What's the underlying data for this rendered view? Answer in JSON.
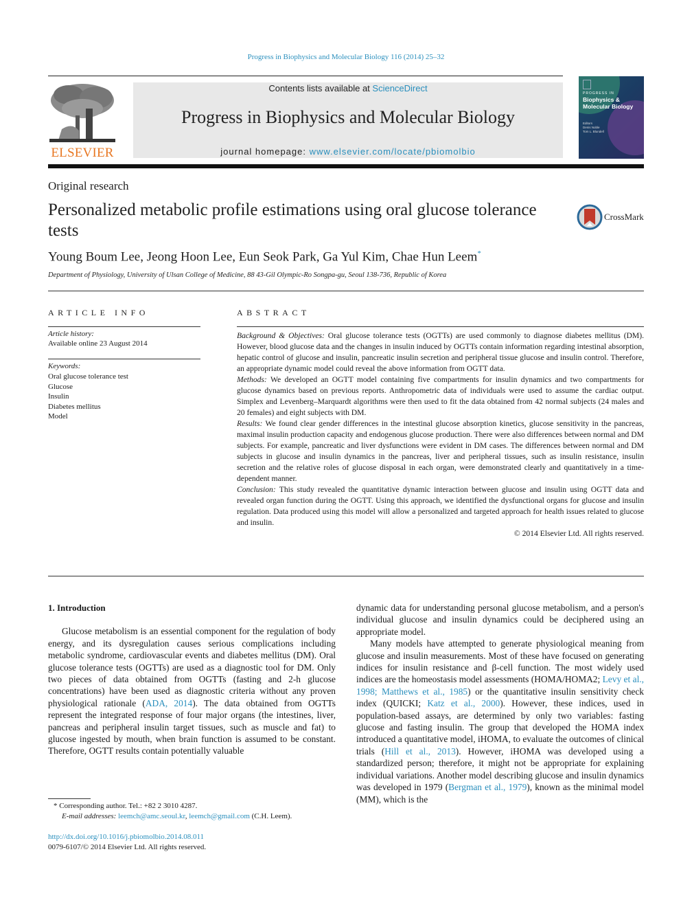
{
  "header": {
    "journal_ref": "Progress in Biophysics and Molecular Biology 116 (2014) 25–32",
    "publisher_logo_text": "ELSEVIER",
    "contents_prefix": "Contents lists available at ",
    "contents_link": "ScienceDirect",
    "journal_title": "Progress in Biophysics and Molecular Biology",
    "homepage_prefix": "journal homepage: ",
    "homepage_link": "www.elsevier.com/locate/pbiomolbio",
    "cover": {
      "small_title": "PROGRESS IN",
      "title": "Biophysics & Molecular Biology",
      "editors_label": "Editors",
      "editors": [
        "Denis Noble",
        "Tom L. Blundell"
      ]
    },
    "colors": {
      "link": "#2a8fbd",
      "elsevier_orange": "#e87722",
      "banner_bg": "#e8e8e8"
    }
  },
  "article": {
    "type": "Original research",
    "title": "Personalized metabolic profile estimations using oral glucose tolerance tests",
    "crossmark_label": "CrossMark",
    "authors": "Young Boum Lee, Jeong Hoon Lee, Eun Seok Park, Ga Yul Kim, Chae Hun Leem",
    "corresponding_mark": "*",
    "affiliation": "Department of Physiology, University of Ulsan College of Medicine, 88 43-Gil Olympic-Ro Songpa-gu, Seoul 138-736, Republic of Korea"
  },
  "article_info": {
    "heading": "ARTICLE INFO",
    "history_label": "Article history:",
    "history_value": "Available online 23 August 2014",
    "keywords_label": "Keywords:",
    "keywords": [
      "Oral glucose tolerance test",
      "Glucose",
      "Insulin",
      "Diabetes mellitus",
      "Model"
    ]
  },
  "abstract": {
    "heading": "ABSTRACT",
    "sections": [
      {
        "label": "Background & Objectives:",
        "text": " Oral glucose tolerance tests (OGTTs) are used commonly to diagnose diabetes mellitus (DM). However, blood glucose data and the changes in insulin induced by OGTTs contain information regarding intestinal absorption, hepatic control of glucose and insulin, pancreatic insulin secretion and peripheral tissue glucose and insulin control. Therefore, an appropriate dynamic model could reveal the above information from OGTT data."
      },
      {
        "label": "Methods:",
        "text": " We developed an OGTT model containing five compartments for insulin dynamics and two compartments for glucose dynamics based on previous reports. Anthropometric data of individuals were used to assume the cardiac output. Simplex and Levenberg–Marquardt algorithms were then used to fit the data obtained from 42 normal subjects (24 males and 20 females) and eight subjects with DM."
      },
      {
        "label": "Results:",
        "text": " We found clear gender differences in the intestinal glucose absorption kinetics, glucose sensitivity in the pancreas, maximal insulin production capacity and endogenous glucose production. There were also differences between normal and DM subjects. For example, pancreatic and liver dysfunctions were evident in DM cases. The differences between normal and DM subjects in glucose and insulin dynamics in the pancreas, liver and peripheral tissues, such as insulin resistance, insulin secretion and the relative roles of glucose disposal in each organ, were demonstrated clearly and quantitatively in a time-dependent manner."
      },
      {
        "label": "Conclusion:",
        "text": " This study revealed the quantitative dynamic interaction between glucose and insulin using OGTT data and revealed organ function during the OGTT. Using this approach, we identified the dysfunctional organs for glucose and insulin regulation. Data produced using this model will allow a personalized and targeted approach for health issues related to glucose and insulin."
      }
    ],
    "copyright": "© 2014 Elsevier Ltd. All rights reserved."
  },
  "body": {
    "section_heading": "1.  Introduction",
    "left_p1_a": "Glucose metabolism is an essential component for the regulation of body energy, and its dysregulation causes serious complications including metabolic syndrome, cardiovascular events and diabetes mellitus (DM). Oral glucose tolerance tests (OGTTs) are used as a diagnostic tool for DM. Only two pieces of data obtained from OGTTs (fasting and 2-h glucose concentrations) have been used as diagnostic criteria without any proven physiological rationale (",
    "left_p1_cite1": "ADA, 2014",
    "left_p1_b": "). The data obtained from OGTTs represent the integrated response of four major organs (the intestines, liver, pancreas and peripheral insulin target tissues, such as muscle and fat) to glucose ingested by mouth, when brain function is assumed to be constant. Therefore, OGTT results contain potentially valuable",
    "right_p1": "dynamic data for understanding personal glucose metabolism, and a person's individual glucose and insulin dynamics could be deciphered using an appropriate model.",
    "right_p2_a": "Many models have attempted to generate physiological meaning from glucose and insulin measurements. Most of these have focused on generating indices for insulin resistance and β-cell function. The most widely used indices are the homeostasis model assessments (HOMA/HOMA2; ",
    "right_p2_cite1": "Levy et al., 1998; Matthews et al., 1985",
    "right_p2_b": ") or the quantitative insulin sensitivity check index (QUICKI; ",
    "right_p2_cite2": "Katz et al., 2000",
    "right_p2_c": "). However, these indices, used in population-based assays, are determined by only two variables: fasting glucose and fasting insulin. The group that developed the HOMA index introduced a quantitative model, iHOMA, to evaluate the outcomes of clinical trials (",
    "right_p2_cite3": "Hill et al., 2013",
    "right_p2_d": "). However, iHOMA was developed using a standardized person; therefore, it might not be appropriate for explaining individual variations. Another model describing glucose and insulin dynamics was developed in 1979 (",
    "right_p2_cite4": "Bergman et al., 1979",
    "right_p2_e": "), known as the minimal model (MM), which is the"
  },
  "footnote": {
    "mark": "*",
    "corresponding": " Corresponding author. Tel.: +82 2 3010 4287.",
    "email_label": "E-mail addresses:",
    "email1": "leemch@amc.seoul.kr",
    "separator": ", ",
    "email2": "leemch@gmail.com",
    "email_suffix": " (C.H. Leem).",
    "doi": "http://dx.doi.org/10.1016/j.pbiomolbio.2014.08.011",
    "issn_copyright": "0079-6107/© 2014 Elsevier Ltd. All rights reserved."
  }
}
